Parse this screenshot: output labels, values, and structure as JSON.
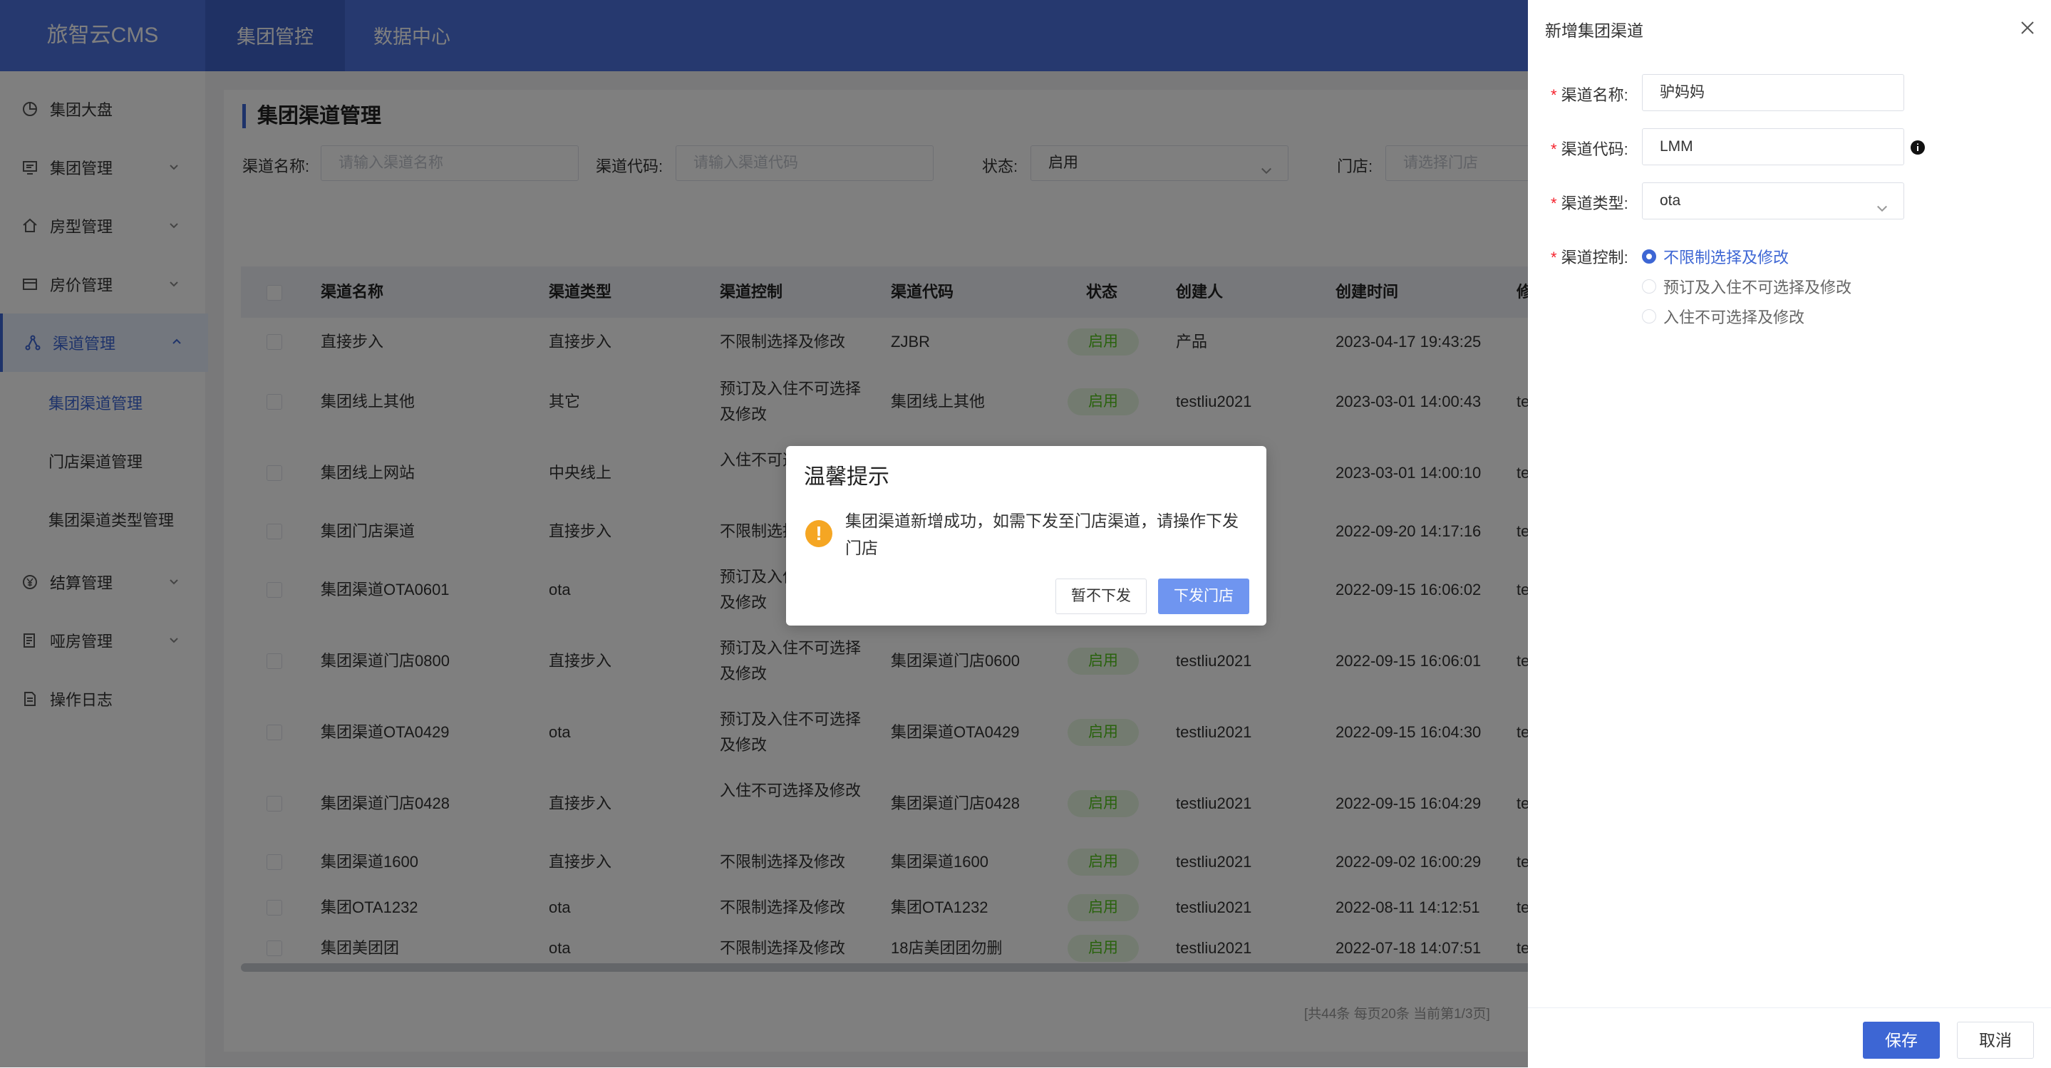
{
  "app": {
    "title": "旅智云CMS"
  },
  "topnav": [
    "集团管控",
    "数据中心"
  ],
  "sidebar": {
    "items": [
      {
        "label": "集团大盘"
      },
      {
        "label": "集团管理"
      },
      {
        "label": "房型管理"
      },
      {
        "label": "房价管理"
      },
      {
        "label": "渠道管理"
      },
      {
        "label": "结算管理"
      },
      {
        "label": "哑房管理"
      },
      {
        "label": "操作日志"
      }
    ],
    "sub_items": [
      "集团渠道管理",
      "门店渠道管理",
      "集团渠道类型管理"
    ]
  },
  "page": {
    "title": "集团渠道管理",
    "filters": {
      "name_label": "渠道名称:",
      "name_placeholder": "请输入渠道名称",
      "code_label": "渠道代码:",
      "code_placeholder": "请输入渠道代码",
      "status_label": "状态:",
      "status_value": "启用",
      "store_label": "门店:",
      "store_placeholder": "请选择门店"
    },
    "table": {
      "headers": [
        "渠道名称",
        "渠道类型",
        "渠道控制",
        "渠道代码",
        "状态",
        "创建人",
        "创建时间",
        "修"
      ],
      "rows": [
        {
          "name": "直接步入",
          "type": "直接步入",
          "control": "不限制选择及修改",
          "code": "ZJBR",
          "status": "启用",
          "creator": "产品",
          "time": "2023-04-17 19:43:25",
          "extra": ""
        },
        {
          "name": "集团线上其他",
          "type": "其它",
          "control": "预订及入住不可选择及修改",
          "code": "集团线上其他",
          "status": "启用",
          "creator": "testliu2021",
          "time": "2023-03-01 14:00:43",
          "extra": "te"
        },
        {
          "name": "集团线上网站",
          "type": "中央线上",
          "control": "入住不可选择及修改",
          "code": "",
          "status": "",
          "creator": "",
          "time": "2023-03-01 14:00:10",
          "extra": "te"
        },
        {
          "name": "集团门店渠道",
          "type": "直接步入",
          "control": "不限制选择及修改",
          "code": "",
          "status": "",
          "creator": "",
          "time": "2022-09-20 14:17:16",
          "extra": "te"
        },
        {
          "name": "集团渠道OTA0601",
          "type": "ota",
          "control": "预订及入住不可选择及修改",
          "code": "",
          "status": "",
          "creator": "",
          "time": "2022-09-15 16:06:02",
          "extra": "te"
        },
        {
          "name": "集团渠道门店0800",
          "type": "直接步入",
          "control": "预订及入住不可选择及修改",
          "code": "集团渠道门店0600",
          "status": "启用",
          "creator": "testliu2021",
          "time": "2022-09-15 16:06:01",
          "extra": "te"
        },
        {
          "name": "集团渠道OTA0429",
          "type": "ota",
          "control": "预订及入住不可选择及修改",
          "code": "集团渠道OTA0429",
          "status": "启用",
          "creator": "testliu2021",
          "time": "2022-09-15 16:04:30",
          "extra": "te"
        },
        {
          "name": "集团渠道门店0428",
          "type": "直接步入",
          "control": "入住不可选择及修改",
          "code": "集团渠道门店0428",
          "status": "启用",
          "creator": "testliu2021",
          "time": "2022-09-15 16:04:29",
          "extra": "te"
        },
        {
          "name": "集团渠道1600",
          "type": "直接步入",
          "control": "不限制选择及修改",
          "code": "集团渠道1600",
          "status": "启用",
          "creator": "testliu2021",
          "time": "2022-09-02 16:00:29",
          "extra": "te"
        },
        {
          "name": "集团OTA1232",
          "type": "ota",
          "control": "不限制选择及修改",
          "code": "集团OTA1232",
          "status": "启用",
          "creator": "testliu2021",
          "time": "2022-08-11 14:12:51",
          "extra": "te"
        },
        {
          "name": "集团美团团",
          "type": "ota",
          "control": "不限制选择及修改",
          "code": "18店美团团勿删",
          "status": "启用",
          "creator": "testliu2021",
          "time": "2022-07-18 14:07:51",
          "extra": "te"
        }
      ]
    },
    "pagination": "[共44条 每页20条 当前第1/3页]"
  },
  "drawer": {
    "title": "新增集团渠道",
    "name_label": "渠道名称:",
    "name_value": "驴妈妈",
    "code_label": "渠道代码:",
    "code_value": "LMM",
    "type_label": "渠道类型:",
    "type_value": "ota",
    "control_label": "渠道控制:",
    "control_options": [
      "不限制选择及修改",
      "预订及入住不可选择及修改",
      "入住不可选择及修改"
    ],
    "control_selected": 0,
    "save": "保存",
    "cancel": "取消"
  },
  "modal": {
    "title": "温馨提示",
    "message": "集团渠道新增成功，如需下发至门店渠道，请操作下发门店",
    "btn_later": "暂不下发",
    "btn_dispatch": "下发门店"
  },
  "colors": {
    "primary": "#3d66d4",
    "topbar": "#4c73de",
    "success": "#52c41a",
    "warning": "#f5a623"
  }
}
